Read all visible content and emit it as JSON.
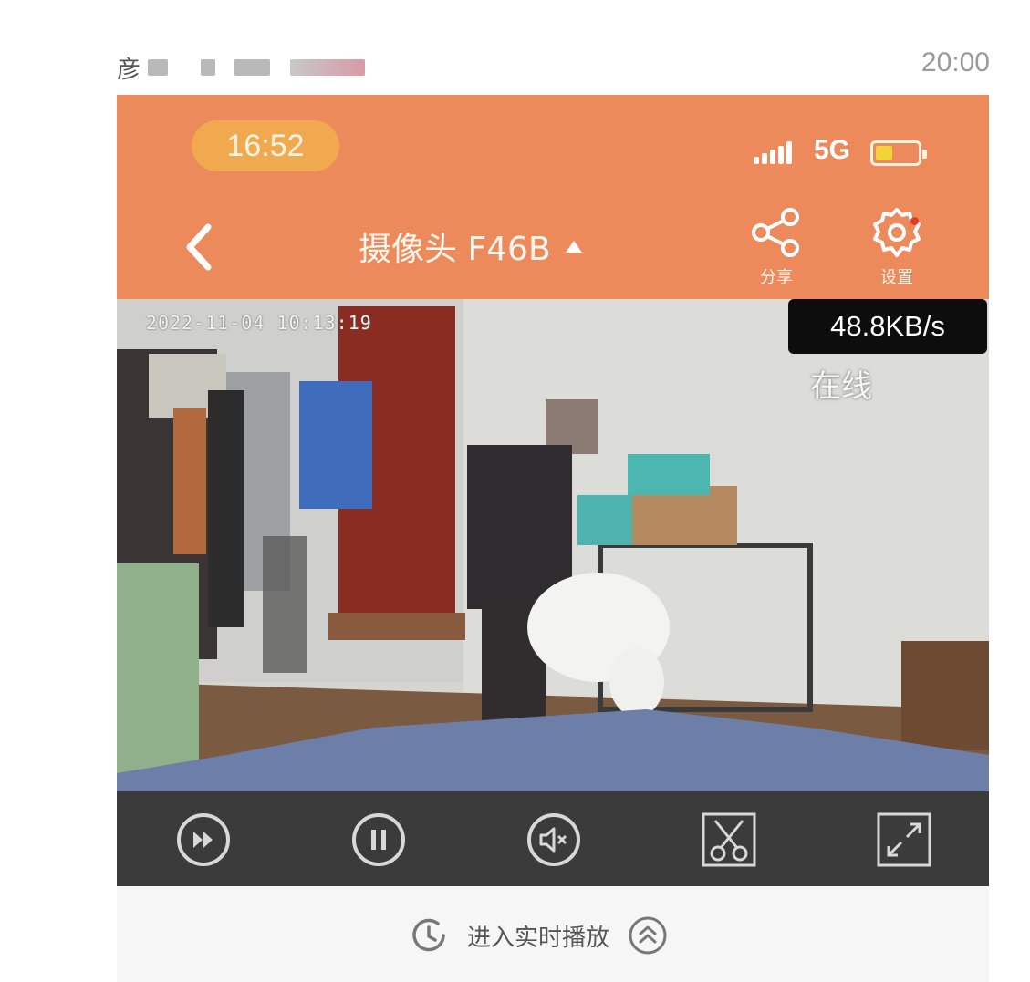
{
  "post": {
    "sender_initial": "彦",
    "time": "20:00"
  },
  "status_bar": {
    "time": "16:52",
    "network": "5G",
    "battery_level": 0.4,
    "icons": [
      "signal-icon",
      "battery-icon"
    ]
  },
  "nav": {
    "title": "摄像头 F46B",
    "share_label": "分享",
    "settings_label": "设置",
    "icons": [
      "back-chevron-icon",
      "caret-up-icon",
      "share-icon",
      "gear-icon"
    ]
  },
  "video": {
    "timestamp": "2022-11-04 10:13:19",
    "bitrate": "48.8KB/s",
    "status": "在线"
  },
  "controls": {
    "icons": [
      "fast-forward-icon",
      "pause-icon",
      "mute-icon",
      "scissors-icon",
      "fullscreen-icon"
    ]
  },
  "live": {
    "label": "进入实时播放",
    "icons": [
      "history-clock-icon",
      "double-chevron-up-icon"
    ]
  },
  "colors": {
    "header_orange": "#ed8a5c",
    "control_bar": "#3b3b3b",
    "clock_pill": "#f1a94f"
  }
}
